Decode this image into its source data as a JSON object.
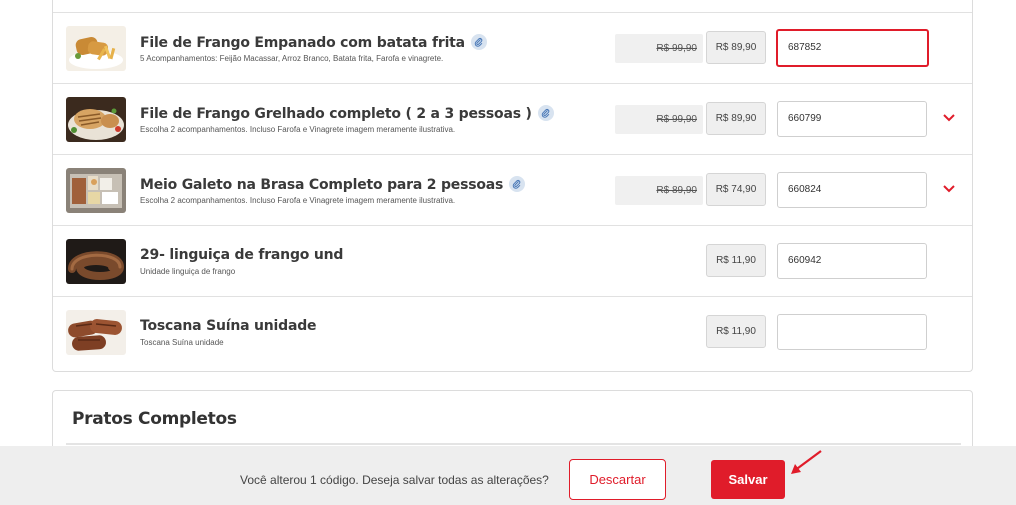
{
  "accent_color": "#e01c2a",
  "products": [
    {
      "title": "File de Frango Empanado com batata frita",
      "has_clip": true,
      "desc": "5 Acompanhamentos: Feijão Macassar, Arroz Branco, Batata frita, Farofa e vinagrete.",
      "old_price": "R$ 99,90",
      "price": "R$ 89,90",
      "code": "687852",
      "code_active": true,
      "has_chevron": false
    },
    {
      "title": "File de Frango Grelhado completo ( 2 a 3 pessoas )",
      "has_clip": true,
      "desc": "Escolha 2 acompanhamentos. Incluso Farofa e Vinagrete imagem meramente ilustrativa.",
      "old_price": "R$ 99,90",
      "price": "R$ 89,90",
      "code": "660799",
      "code_active": false,
      "has_chevron": true
    },
    {
      "title": "Meio Galeto na Brasa Completo para 2 pessoas",
      "has_clip": true,
      "desc": "Escolha 2 acompanhamentos. Incluso Farofa e Vinagrete imagem meramente ilustrativa.",
      "old_price": "R$ 89,90",
      "price": "R$ 74,90",
      "code": "660824",
      "code_active": false,
      "has_chevron": true
    },
    {
      "title": "29- linguiça de frango und",
      "has_clip": false,
      "desc": "Unidade linguiça de frango",
      "old_price": "",
      "price": "R$ 11,90",
      "code": "660942",
      "code_active": false,
      "has_chevron": false
    },
    {
      "title": "Toscana Suína unidade",
      "has_clip": false,
      "desc": "Toscana Suína unidade",
      "old_price": "",
      "price": "R$ 11,90",
      "code": "",
      "code_active": false,
      "has_chevron": false
    }
  ],
  "section": {
    "title": "Pratos Completos"
  },
  "savebar": {
    "message": "Você alterou 1 código. Deseja salvar todas as alterações?",
    "discard_label": "Descartar",
    "save_label": "Salvar"
  }
}
